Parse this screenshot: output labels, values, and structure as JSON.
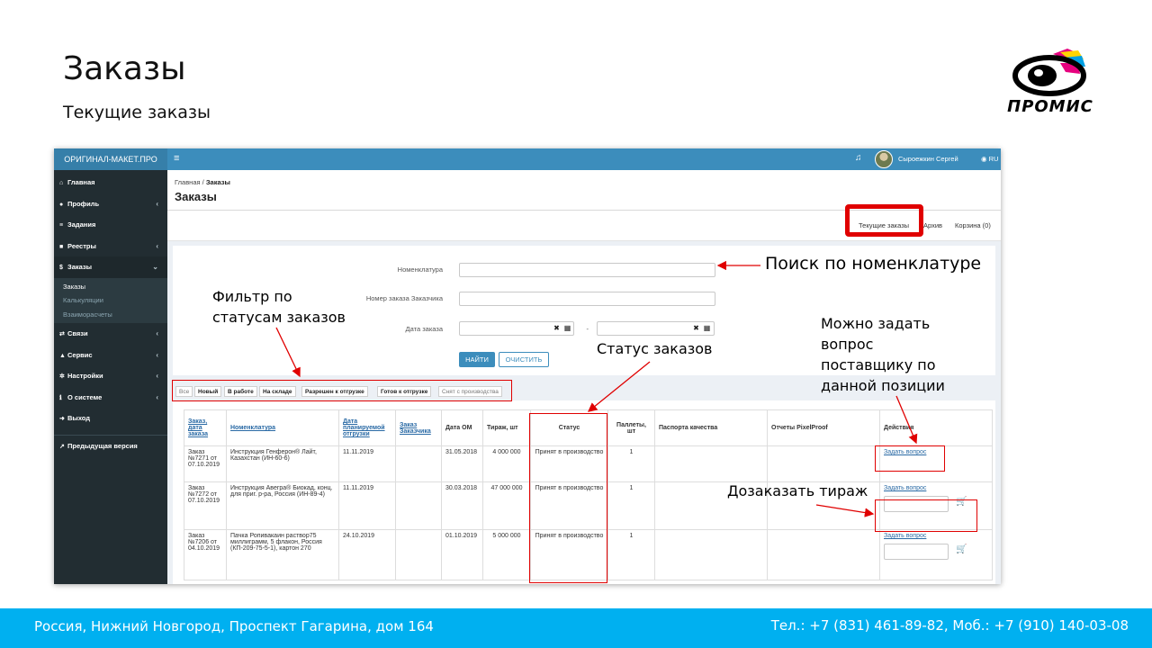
{
  "slide": {
    "title": "Заказы",
    "subtitle": "Текущие заказы",
    "logo_text": "ПРОМИС"
  },
  "sidebar": {
    "brand": "ОРИГИНАЛ-МАКЕТ.ПРО",
    "items": [
      {
        "label": "Главная",
        "icon": "home-icon"
      },
      {
        "label": "Профиль",
        "icon": "user-icon"
      },
      {
        "label": "Задания",
        "icon": "list-icon"
      },
      {
        "label": "Реестры",
        "icon": "grid-icon"
      },
      {
        "label": "Заказы",
        "icon": "dollar-icon"
      },
      {
        "label": "Связи",
        "icon": "exchange-icon"
      },
      {
        "label": "Сервис",
        "icon": "bell-icon"
      },
      {
        "label": "Настройки",
        "icon": "gear-icon"
      },
      {
        "label": "О системе",
        "icon": "info-icon"
      },
      {
        "label": "Выход",
        "icon": "logout-icon"
      },
      {
        "label": "Предыдущая версия",
        "icon": "external-link-icon"
      }
    ],
    "sub": [
      "Заказы",
      "Калькуляции",
      "Взаиморасчеты"
    ]
  },
  "topbar": {
    "user": "Сыроежкин Сергей",
    "lang": "RU"
  },
  "page": {
    "crumb_home": "Главная",
    "crumb_sep": "/",
    "crumb_current": "Заказы",
    "title": "Заказы",
    "tabs": [
      "Текущие заказы",
      "Архив",
      "Корзина (0)"
    ]
  },
  "form": {
    "nomenclature_label": "Номенклатура",
    "order_number_label": "Номер заказа Заказчика",
    "date_label": "Дата заказа",
    "date_dash": "-",
    "find_button": "НАЙТИ",
    "clear_button": "ОЧИСТИТЬ"
  },
  "filters": [
    "Все",
    "Новый",
    "В работе",
    "На складе",
    "Разрешен к отгрузке",
    "Готов к отгрузке",
    "Снят с производства"
  ],
  "table": {
    "headers": [
      "Заказ, дата заказа",
      "Номенклатура",
      "Дата планируемой отгрузки",
      "Заказ Заказчика",
      "Дата ОМ",
      "Тираж, шт",
      "Статус",
      "Паллеты, шт",
      "Паспорта качества",
      "Отчеты PixelProof",
      "Действия"
    ],
    "rows": [
      {
        "order": "Заказ №7271 от 07.10.2019",
        "name": "Инструкция Генферон® Лайт, Казахстан (ИН-60-6)",
        "ship": "11.11.2019",
        "client": "",
        "om": "31.05.2018",
        "qty": "4 000 000",
        "status": "Принят в производство",
        "pallets": "1",
        "action": "Задать вопрос"
      },
      {
        "order": "Заказ №7272 от 07.10.2019",
        "name": "Инструкция Авегра® Биокад, конц. для приг. р-ра, Россия (ИН-89-4)",
        "ship": "11.11.2019",
        "client": "",
        "om": "30.03.2018",
        "qty": "47 000 000",
        "status": "Принят в производство",
        "pallets": "1",
        "action": "Задать вопрос"
      },
      {
        "order": "Заказ №7206 от 04.10.2019",
        "name": "Пачка Ропивакаин раствор75 миллиграмм, 5 флакон, Россия (КП-209-75-5-1), картон 270",
        "ship": "24.10.2019",
        "client": "",
        "om": "01.10.2019",
        "qty": "5 000 000",
        "status": "Принят в производство",
        "pallets": "1",
        "action": "Задать вопрос"
      }
    ]
  },
  "annotations": {
    "search": "Поиск по номенклатуре",
    "filter_line1": "Фильтр по",
    "filter_line2": "статусам заказов",
    "status": "Статус заказов",
    "ask_line1": "Можно задать",
    "ask_line2": "вопрос",
    "ask_line3": "поставщику по",
    "ask_line4": "данной позиции",
    "reorder": "Дозаказать тираж"
  },
  "footer": {
    "address": "Россия, Нижний Новгород, Проспект Гагарина, дом 164",
    "phones": "Тел.: +7 (831) 461-89-82, Моб.: +7 (910) 140-03-08"
  },
  "colors": {
    "footer_bg": "#00b0f0",
    "sidebar_bg": "#222d32",
    "topbar_bg": "#3c8dbc",
    "annotation_red": "#e00000"
  }
}
